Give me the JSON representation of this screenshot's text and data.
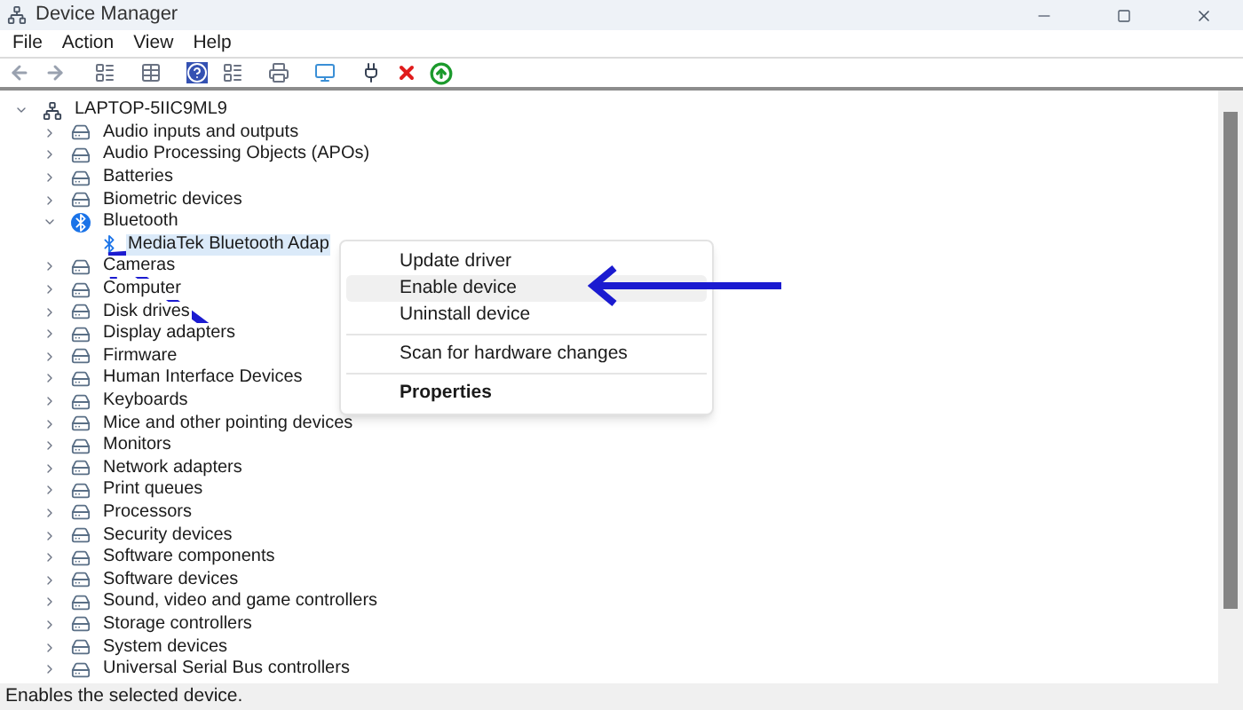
{
  "window": {
    "title": "Device Manager"
  },
  "menu": [
    "File",
    "Action",
    "View",
    "Help"
  ],
  "tree": {
    "label": "LAPTOP-5IIC9ML9",
    "expanded": true,
    "selected": false,
    "children": [
      {
        "label": "Audio inputs and outputs",
        "expanded": false,
        "selected": false
      },
      {
        "label": "Audio Processing Objects (APOs)",
        "expanded": false,
        "selected": false
      },
      {
        "label": "Batteries",
        "expanded": false,
        "selected": false
      },
      {
        "label": "Biometric devices",
        "expanded": false,
        "selected": false
      },
      {
        "label": "Bluetooth",
        "expanded": true,
        "selected": false,
        "children": [
          {
            "label": "MediaTek Bluetooth Adap",
            "selected": true
          }
        ]
      },
      {
        "label": "Cameras",
        "expanded": false,
        "selected": false
      },
      {
        "label": "Computer",
        "expanded": false,
        "selected": false
      },
      {
        "label": "Disk drives",
        "expanded": false,
        "selected": false
      },
      {
        "label": "Display adapters",
        "expanded": false,
        "selected": false
      },
      {
        "label": "Firmware",
        "expanded": false,
        "selected": false
      },
      {
        "label": "Human Interface Devices",
        "expanded": false,
        "selected": false
      },
      {
        "label": "Keyboards",
        "expanded": false,
        "selected": false
      },
      {
        "label": "Mice and other pointing devices",
        "expanded": false,
        "selected": false
      },
      {
        "label": "Monitors",
        "expanded": false,
        "selected": false
      },
      {
        "label": "Network adapters",
        "expanded": false,
        "selected": false
      },
      {
        "label": "Print queues",
        "expanded": false,
        "selected": false
      },
      {
        "label": "Processors",
        "expanded": false,
        "selected": false
      },
      {
        "label": "Security devices",
        "expanded": false,
        "selected": false
      },
      {
        "label": "Software components",
        "expanded": false,
        "selected": false
      },
      {
        "label": "Software devices",
        "expanded": false,
        "selected": false
      },
      {
        "label": "Sound, video and game controllers",
        "expanded": false,
        "selected": false
      },
      {
        "label": "Storage controllers",
        "expanded": false,
        "selected": false
      },
      {
        "label": "System devices",
        "expanded": false,
        "selected": false
      },
      {
        "label": "Universal Serial Bus controllers",
        "expanded": false,
        "selected": false
      }
    ]
  },
  "context_menu": [
    {
      "kind": "item",
      "label": "Update driver",
      "selected": false
    },
    {
      "kind": "item",
      "label": "Enable device",
      "selected": true
    },
    {
      "kind": "item",
      "label": "Uninstall device",
      "selected": false
    },
    {
      "kind": "separator"
    },
    {
      "kind": "item",
      "label": "Scan for hardware changes",
      "selected": false
    },
    {
      "kind": "separator"
    },
    {
      "kind": "default",
      "label": "Properties",
      "selected": false
    }
  ],
  "status_bar": "Enables the selected device."
}
